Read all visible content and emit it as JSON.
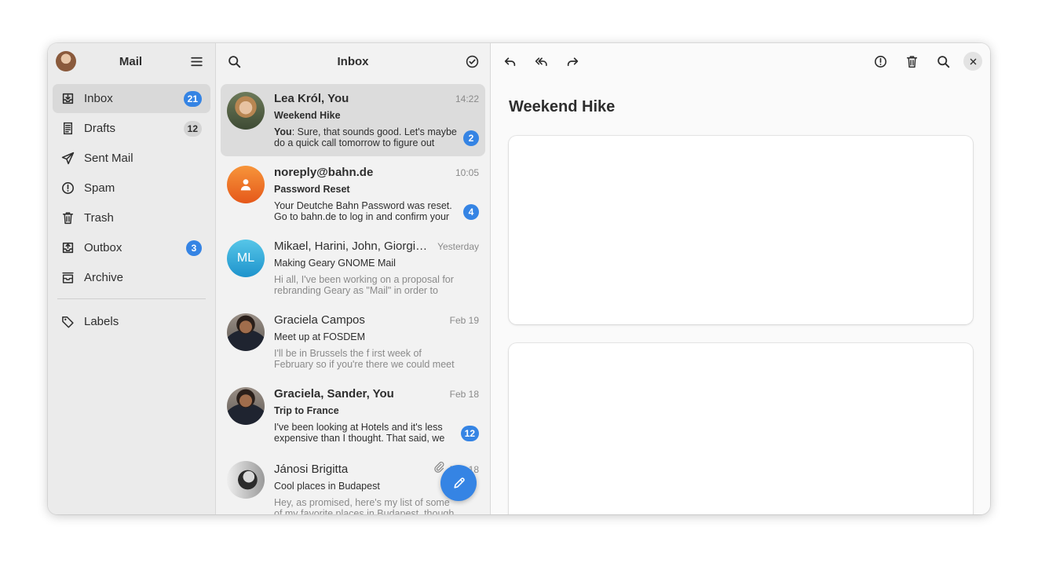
{
  "app": {
    "title": "Mail"
  },
  "sidebar": {
    "items": [
      {
        "label": "Inbox",
        "icon": "inbox-icon",
        "badge": "21",
        "badge_style": "blue",
        "active": true
      },
      {
        "label": "Drafts",
        "icon": "drafts-icon",
        "badge": "12",
        "badge_style": "grey"
      },
      {
        "label": "Sent Mail",
        "icon": "send-icon"
      },
      {
        "label": "Spam",
        "icon": "spam-icon"
      },
      {
        "label": "Trash",
        "icon": "trash-icon"
      },
      {
        "label": "Outbox",
        "icon": "outbox-icon",
        "badge": "3",
        "badge_style": "blue"
      },
      {
        "label": "Archive",
        "icon": "archive-icon"
      }
    ],
    "labels_item": {
      "label": "Labels",
      "icon": "tag-icon"
    }
  },
  "message_list": {
    "title": "Inbox",
    "messages": [
      {
        "sender": "Lea Król, You",
        "date": "14:22",
        "subject": "Weekend Hike",
        "preview_prefix": "You",
        "preview": ": Sure, that sounds good. Let's maybe do a quick call tomorrow to figure out the…",
        "badge": "2",
        "unread": true,
        "selected": true,
        "avatar": "photo"
      },
      {
        "sender": "noreply@bahn.de",
        "date": "10:05",
        "subject": "Password Reset",
        "preview": "Your Deutche Bahn Password was reset. Go to bahn.de to log in and confirm your ne…",
        "badge": "4",
        "unread": true,
        "avatar": "generic"
      },
      {
        "sender": "Mikael, Harini, John, Giorgia,…",
        "date": "Yesterday",
        "subject": "Making Geary GNOME Mail",
        "preview": "Hi all, I've been working on a proposal for rebranding Geary as \"Mail\" in order to integrat…",
        "avatar": "initials",
        "initials": "ML"
      },
      {
        "sender": "Graciela Campos",
        "date": "Feb 19",
        "subject": "Meet up at FOSDEM",
        "preview": "I'll be in Brussels the f irst week of February so if you're there we could meet up on the 3rd of 3t…",
        "avatar": "photo"
      },
      {
        "sender": "Graciela, Sander, You",
        "date": "Feb 18",
        "subject": "Trip to France",
        "preview": "I've been looking at Hotels and it's less expensive than I thought. That said, we s…",
        "badge": "12",
        "unread": true,
        "avatar": "photo"
      },
      {
        "sender": "Jánosi Brigitta",
        "date": "Feb 18",
        "subject": "Cool places in Budapest",
        "preview": "Hey, as promised, here's my list of some of my favorite places in Budapest, though I might ha…",
        "avatar": "photo",
        "attachment": true
      }
    ]
  },
  "reader": {
    "title": "Weekend Hike"
  },
  "colors": {
    "accent": "#3584e4",
    "orange": "#ed6a1e",
    "teal": "#2fa5d6"
  }
}
